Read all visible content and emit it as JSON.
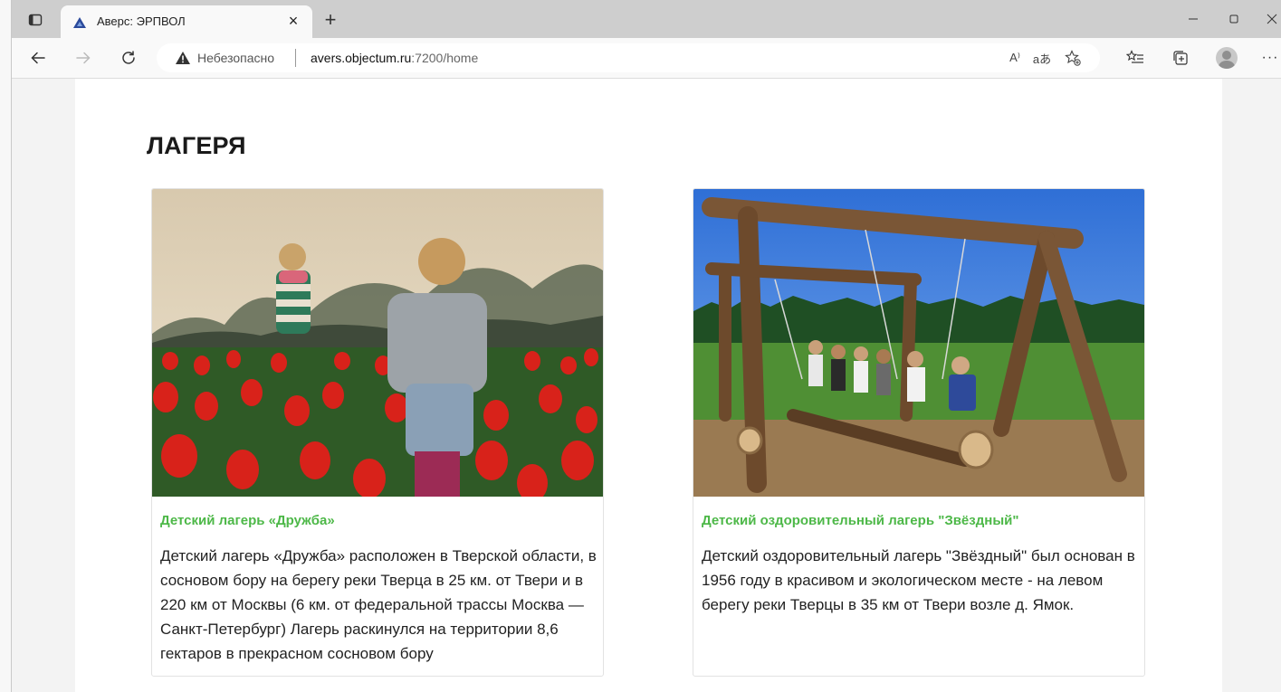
{
  "browser": {
    "tab": {
      "title": "Аверс: ЭРПВОЛ",
      "close_glyph": "×",
      "favicon": "triangle-logo-icon"
    },
    "new_tab_glyph": "+",
    "window_controls": {
      "minimize_glyph": "—",
      "maximize_glyph": "▢",
      "close_glyph": "✕"
    },
    "address": {
      "security_label": "Небезопасно",
      "host": "avers.objectum.ru",
      "path": ":7200/home"
    },
    "address_buttons": {
      "read_aloud_glyph": "A⁾",
      "translate_glyph": "aあ",
      "more_glyph": "···"
    }
  },
  "page": {
    "section_title": "ЛАГЕРЯ",
    "cards": [
      {
        "title": "Детский лагерь «Дружба»",
        "text": "Детский лагерь «Дружба» расположен в Тверской области, в сосновом бору на берегу реки Тверца в 25 км. от Твери и в 220 км от Москвы (6 км. от федеральной трассы Москва — Санкт-Петербург) Лагерь раскинулся на территории 8,6 гектаров в прекрасном сосновом бору",
        "image": "children-in-tulip-field"
      },
      {
        "title": "Детский оздоровительный лагерь \"Звёздный\"",
        "text": "Детский оздоровительный лагерь \"Звёздный\" был основан в 1956 году в красивом и экологическом месте - на левом берегу реки Тверцы в 35 км от Твери возле д. Ямок.",
        "image": "kids-on-wooden-swing"
      }
    ]
  },
  "colors": {
    "accent_green": "#4db848",
    "tab_strip": "#cecece",
    "toolbar": "#f9f9f9"
  }
}
